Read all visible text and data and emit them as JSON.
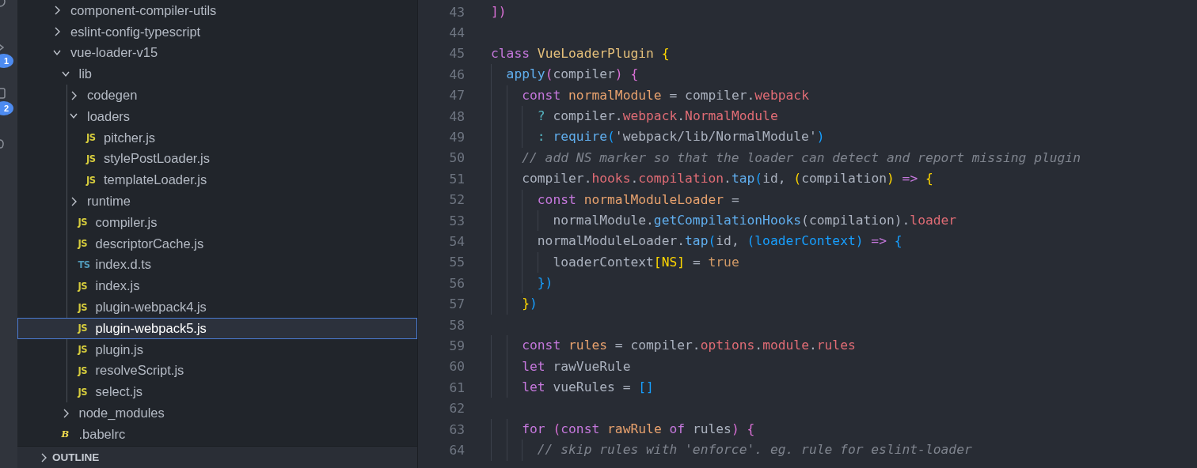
{
  "activity_bar": {
    "badges": [
      "1",
      "2"
    ]
  },
  "explorer": {
    "tree": [
      {
        "name": "component-compiler-utils",
        "kind": "folder",
        "expanded": false,
        "selected": false
      },
      {
        "name": "eslint-config-typescript",
        "kind": "folder",
        "expanded": false,
        "selected": false
      },
      {
        "name": "vue-loader-v15",
        "kind": "folder",
        "expanded": true,
        "selected": false,
        "children": [
          {
            "name": "lib",
            "kind": "folder",
            "expanded": true,
            "selected": false,
            "children": [
              {
                "name": "codegen",
                "kind": "folder",
                "expanded": false,
                "selected": false
              },
              {
                "name": "loaders",
                "kind": "folder",
                "expanded": true,
                "selected": false,
                "children": [
                  {
                    "name": "pitcher.js",
                    "kind": "js",
                    "badge": "JS",
                    "selected": false
                  },
                  {
                    "name": "stylePostLoader.js",
                    "kind": "js",
                    "badge": "JS",
                    "selected": false
                  },
                  {
                    "name": "templateLoader.js",
                    "kind": "js",
                    "badge": "JS",
                    "selected": false
                  }
                ]
              },
              {
                "name": "runtime",
                "kind": "folder",
                "expanded": false,
                "selected": false
              },
              {
                "name": "compiler.js",
                "kind": "js",
                "badge": "JS",
                "selected": false
              },
              {
                "name": "descriptorCache.js",
                "kind": "js",
                "badge": "JS",
                "selected": false
              },
              {
                "name": "index.d.ts",
                "kind": "ts",
                "badge": "TS",
                "selected": false
              },
              {
                "name": "index.js",
                "kind": "js",
                "badge": "JS",
                "selected": false
              },
              {
                "name": "plugin-webpack4.js",
                "kind": "js",
                "badge": "JS",
                "selected": false
              },
              {
                "name": "plugin-webpack5.js",
                "kind": "js",
                "badge": "JS",
                "selected": true
              },
              {
                "name": "plugin.js",
                "kind": "js",
                "badge": "JS",
                "selected": false
              },
              {
                "name": "resolveScript.js",
                "kind": "js",
                "badge": "JS",
                "selected": false
              },
              {
                "name": "select.js",
                "kind": "js",
                "badge": "JS",
                "selected": false
              }
            ]
          },
          {
            "name": "node_modules",
            "kind": "folder",
            "expanded": false,
            "selected": false
          }
        ]
      },
      {
        "name": ".babelrc",
        "kind": "babel",
        "badge": "B",
        "selected": false
      }
    ],
    "outline": {
      "title": "OUTLINE",
      "expanded": false
    }
  },
  "editor": {
    "lines": [
      {
        "number": "43",
        "tokens": [
          {
            "text": "])",
            "kind": "bracket2"
          }
        ]
      },
      {
        "number": "44"
      },
      {
        "number": "45",
        "tokens": [
          {
            "text": "class ",
            "kind": "keyword"
          },
          {
            "text": "VueLoaderPlugin ",
            "kind": "class"
          },
          {
            "text": "{",
            "kind": "bracket1"
          }
        ]
      },
      {
        "number": "46",
        "tokens": [
          {
            "text": "  apply",
            "kind": "func"
          },
          {
            "text": "(",
            "kind": "bracket2"
          },
          {
            "text": "compiler",
            "kind": "plain"
          },
          {
            "text": ") {",
            "kind": "bracket2"
          }
        ]
      },
      {
        "number": "47",
        "tokens": [
          {
            "text": "    const ",
            "kind": "keyword"
          },
          {
            "text": "normalModule",
            "kind": "variable"
          },
          {
            "text": " = compiler.",
            "kind": "plain"
          },
          {
            "text": "webpack",
            "kind": "prop"
          }
        ]
      },
      {
        "number": "48",
        "tokens": [
          {
            "text": "      ? ",
            "kind": "operator"
          },
          {
            "text": "compiler.",
            "kind": "plain"
          },
          {
            "text": "webpack",
            "kind": "prop"
          },
          {
            "text": ".",
            "kind": "plain"
          },
          {
            "text": "NormalModule",
            "kind": "prop"
          }
        ]
      },
      {
        "number": "49",
        "tokens": [
          {
            "text": "      : ",
            "kind": "operator"
          },
          {
            "text": "require",
            "kind": "func"
          },
          {
            "text": "(",
            "kind": "bracket3"
          },
          {
            "text": "'webpack/lib/NormalModule'",
            "kind": "plain"
          },
          {
            "text": ")",
            "kind": "bracket3"
          }
        ]
      },
      {
        "number": "50",
        "tokens": [
          {
            "text": "    // add NS marker so that the loader can detect and report missing plugin",
            "kind": "comment"
          }
        ]
      },
      {
        "number": "51",
        "tokens": [
          {
            "text": "    compiler.",
            "kind": "plain"
          },
          {
            "text": "hooks",
            "kind": "prop"
          },
          {
            "text": ".",
            "kind": "plain"
          },
          {
            "text": "compilation",
            "kind": "prop"
          },
          {
            "text": ".",
            "kind": "plain"
          },
          {
            "text": "tap",
            "kind": "func"
          },
          {
            "text": "(",
            "kind": "bracket3"
          },
          {
            "text": "id, ",
            "kind": "plain"
          },
          {
            "text": "(",
            "kind": "bracket1"
          },
          {
            "text": "compilation",
            "kind": "plain"
          },
          {
            "text": ")",
            "kind": "bracket1"
          },
          {
            "text": " => ",
            "kind": "keyword"
          },
          {
            "text": "{",
            "kind": "bracket1"
          }
        ]
      },
      {
        "number": "52",
        "tokens": [
          {
            "text": "      const ",
            "kind": "keyword"
          },
          {
            "text": "normalModuleLoader",
            "kind": "variable"
          },
          {
            "text": " =",
            "kind": "plain"
          }
        ]
      },
      {
        "number": "53",
        "tokens": [
          {
            "text": "        normalModule.",
            "kind": "plain"
          },
          {
            "text": "getCompilationHooks",
            "kind": "func"
          },
          {
            "text": "(compilation).",
            "kind": "plain"
          },
          {
            "text": "loader",
            "kind": "prop"
          }
        ]
      },
      {
        "number": "54",
        "tokens": [
          {
            "text": "      normalModuleLoader.",
            "kind": "plain"
          },
          {
            "text": "tap",
            "kind": "func"
          },
          {
            "text": "(",
            "kind": "bracket3"
          },
          {
            "text": "id, ",
            "kind": "plain"
          },
          {
            "text": "(loaderContext)",
            "kind": "bracket3"
          },
          {
            "text": " => ",
            "kind": "keyword"
          },
          {
            "text": "{",
            "kind": "bracket3"
          }
        ]
      },
      {
        "number": "55",
        "tokens": [
          {
            "text": "        loaderContext",
            "kind": "plain"
          },
          {
            "text": "[NS]",
            "kind": "bracket1"
          },
          {
            "text": " = ",
            "kind": "plain"
          },
          {
            "text": "true",
            "kind": "literal"
          }
        ]
      },
      {
        "number": "56",
        "tokens": [
          {
            "text": "      })",
            "kind": "bracket3"
          }
        ]
      },
      {
        "number": "57",
        "tokens": [
          {
            "text": "    }",
            "kind": "bracket1"
          },
          {
            "text": ")",
            "kind": "bracket3"
          }
        ]
      },
      {
        "number": "58"
      },
      {
        "number": "59",
        "tokens": [
          {
            "text": "    const ",
            "kind": "keyword"
          },
          {
            "text": "rules",
            "kind": "variable"
          },
          {
            "text": " = compiler.",
            "kind": "plain"
          },
          {
            "text": "options",
            "kind": "prop"
          },
          {
            "text": ".",
            "kind": "plain"
          },
          {
            "text": "module",
            "kind": "prop"
          },
          {
            "text": ".",
            "kind": "plain"
          },
          {
            "text": "rules",
            "kind": "prop"
          }
        ]
      },
      {
        "number": "60",
        "tokens": [
          {
            "text": "    let ",
            "kind": "keyword"
          },
          {
            "text": "rawVueRule",
            "kind": "plain"
          }
        ]
      },
      {
        "number": "61",
        "tokens": [
          {
            "text": "    let ",
            "kind": "keyword"
          },
          {
            "text": "vueRules = ",
            "kind": "plain"
          },
          {
            "text": "[]",
            "kind": "bracket3"
          }
        ]
      },
      {
        "number": "62"
      },
      {
        "number": "63",
        "tokens": [
          {
            "text": "    for ",
            "kind": "keyword"
          },
          {
            "text": "(",
            "kind": "bracket2"
          },
          {
            "text": "const ",
            "kind": "keyword"
          },
          {
            "text": "rawRule ",
            "kind": "variable"
          },
          {
            "text": "of ",
            "kind": "keyword"
          },
          {
            "text": "rules",
            "kind": "plain"
          },
          {
            "text": ") {",
            "kind": "bracket2"
          }
        ]
      },
      {
        "number": "64",
        "tokens": [
          {
            "text": "      // skip rules with 'enforce'. eg. rule for eslint-loader",
            "kind": "comment"
          }
        ]
      }
    ]
  }
}
